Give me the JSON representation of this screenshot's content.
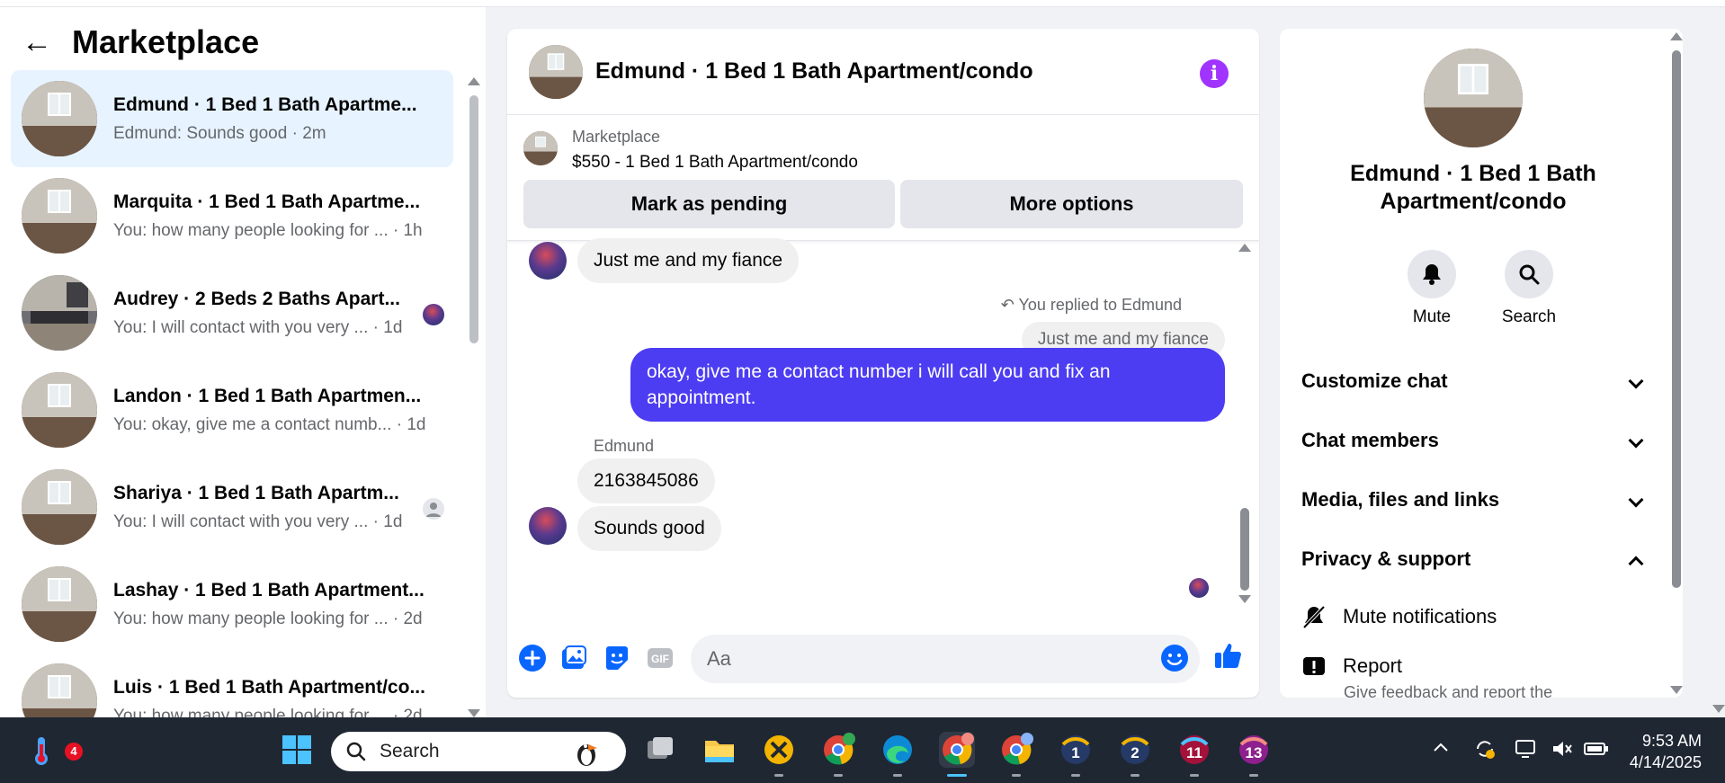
{
  "sidebar": {
    "title": "Marketplace",
    "conversations": [
      {
        "name": "Edmund · 1 Bed 1 Bath Apartme...",
        "preview": "Edmund: Sounds good · 2m",
        "active": true
      },
      {
        "name": "Marquita · 1 Bed 1 Bath Apartme...",
        "preview": "You: how many people looking for ... · 1h"
      },
      {
        "name": "Audrey · 2 Beds 2 Baths Apart...",
        "preview": "You: I will contact with you very ... · 1d"
      },
      {
        "name": "Landon · 1 Bed 1 Bath Apartmen...",
        "preview": "You: okay, give me a contact numb... · 1d"
      },
      {
        "name": "Shariya · 1 Bed 1 Bath Apartm...",
        "preview": "You: I will contact with you very ... · 1d"
      },
      {
        "name": "Lashay · 1 Bed 1 Bath Apartment...",
        "preview": "You: how many people looking for ... · 2d"
      },
      {
        "name": "Luis · 1 Bed 1 Bath Apartment/co...",
        "preview": "You: how many people looking for ... · 2d"
      }
    ]
  },
  "chat": {
    "title": "Edmund · 1 Bed 1 Bath Apartment/condo",
    "listing_source": "Marketplace",
    "listing_title": "$550 - 1 Bed 1 Bath Apartment/condo",
    "pending_label": "Mark as pending",
    "more_label": "More options",
    "messages": {
      "m1": "Just me and my fiance",
      "replied_note": "You replied to Edmund",
      "quoted": "Just me and my fiance",
      "outgoing": "okay, give me a contact number i will call you and fix an appointment.",
      "sender": "Edmund",
      "m2": "2163845086",
      "m3": "Sounds good"
    },
    "composer_placeholder": "Aa"
  },
  "details": {
    "name": "Edmund · 1 Bed 1 Bath Apartment/condo",
    "mute_label": "Mute",
    "search_label": "Search",
    "sections": {
      "customize": "Customize chat",
      "members": "Chat members",
      "media": "Media, files and links",
      "privacy": "Privacy & support"
    },
    "mute_notifications": "Mute notifications",
    "report": "Report",
    "report_sub": "Give feedback and report the"
  },
  "taskbar": {
    "search_label": "Search",
    "weather_badge": "4",
    "app_numbers": [
      "1",
      "2",
      "11",
      "13"
    ],
    "time": "9:53 AM",
    "date": "4/14/2025"
  },
  "colors": {
    "accent": "#4c3cf2",
    "active_conv": "#e7f3ff",
    "info": "#a033ff",
    "messenger_blue": "#0866ff"
  }
}
